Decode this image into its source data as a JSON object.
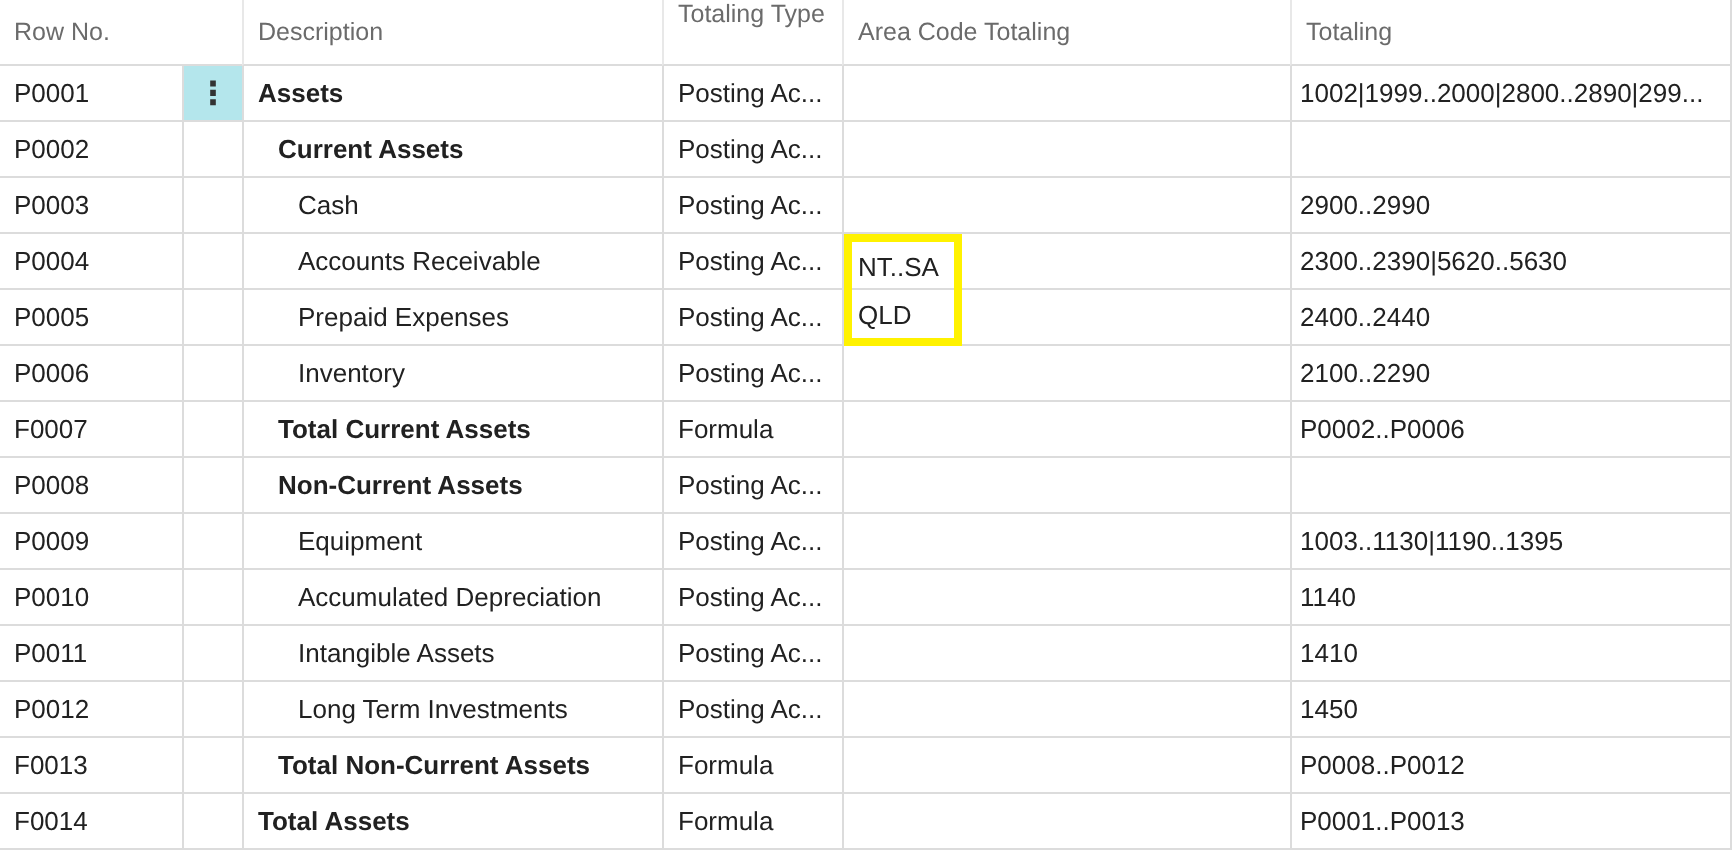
{
  "table": {
    "columns": [
      {
        "label": "Row No."
      },
      {
        "label": "Description"
      },
      {
        "label": "Totaling Type"
      },
      {
        "label": "Area Code Totaling"
      },
      {
        "label": "Totaling"
      }
    ],
    "row_action": "⋮",
    "rows": [
      {
        "row_no": "P0001",
        "description": "Assets",
        "bold": true,
        "totaling_type": "Posting Ac...",
        "totaling": "1002|1999..2000|2800..2890|299...",
        "selected": true,
        "children": [
          {
            "row_no": "P0002",
            "description": "Current Assets",
            "bold": true,
            "totaling_type": "Posting Ac...",
            "selected": false,
            "children": [
              {
                "row_no": "P0003",
                "description": "Cash",
                "bold": false,
                "totaling_type": "Posting Ac...",
                "totaling": "2900..2990",
                "selected": false
              },
              {
                "row_no": "P0004",
                "description": "Accounts Receivable",
                "bold": false,
                "totaling_type": "Posting Ac...",
                "area_code_totaling": "NT..SA",
                "highlighted": true,
                "totaling": "2300..2390|5620..5630",
                "selected": false
              },
              {
                "row_no": "P0005",
                "description": "Prepaid Expenses",
                "bold": false,
                "totaling_type": "Posting Ac...",
                "area_code_totaling": "QLD",
                "highlighted": true,
                "totaling": "2400..2440",
                "selected": false
              },
              {
                "row_no": "P0006",
                "description": "Inventory",
                "bold": false,
                "totaling_type": "Posting Ac...",
                "totaling": "2100..2290",
                "selected": false
              }
            ]
          },
          {
            "row_no": "F0007",
            "description": "Total Current Assets",
            "bold": true,
            "totaling_type": "Formula",
            "totaling": "P0002..P0006",
            "selected": false
          },
          {
            "row_no": "P0008",
            "description": "Non-Current Assets",
            "bold": true,
            "totaling_type": "Posting Ac...",
            "selected": false,
            "children": [
              {
                "row_no": "P0009",
                "description": "Equipment",
                "bold": false,
                "totaling_type": "Posting Ac...",
                "totaling": "1003..1130|1190..1395",
                "selected": false
              },
              {
                "row_no": "P0010",
                "description": "Accumulated Depreciation",
                "bold": false,
                "totaling_type": "Posting Ac...",
                "totaling": "1140",
                "selected": false
              },
              {
                "row_no": "P0011",
                "description": "Intangible Assets",
                "bold": false,
                "totaling_type": "Posting Ac...",
                "totaling": "1410",
                "selected": false
              },
              {
                "row_no": "P0012",
                "description": "Long Term Investments",
                "bold": false,
                "totaling_type": "Posting Ac...",
                "totaling": "1450",
                "selected": false
              }
            ]
          },
          {
            "row_no": "F0013",
            "description": "Total Non-Current Assets",
            "bold": true,
            "totaling_type": "Formula",
            "totaling": "P0008..P0012",
            "selected": false
          }
        ]
      },
      {
        "row_no": "F0014",
        "description": "Total Assets",
        "bold": true,
        "totaling_type": "Formula",
        "totaling": "P0001..P0013",
        "selected": false
      }
    ]
  }
}
